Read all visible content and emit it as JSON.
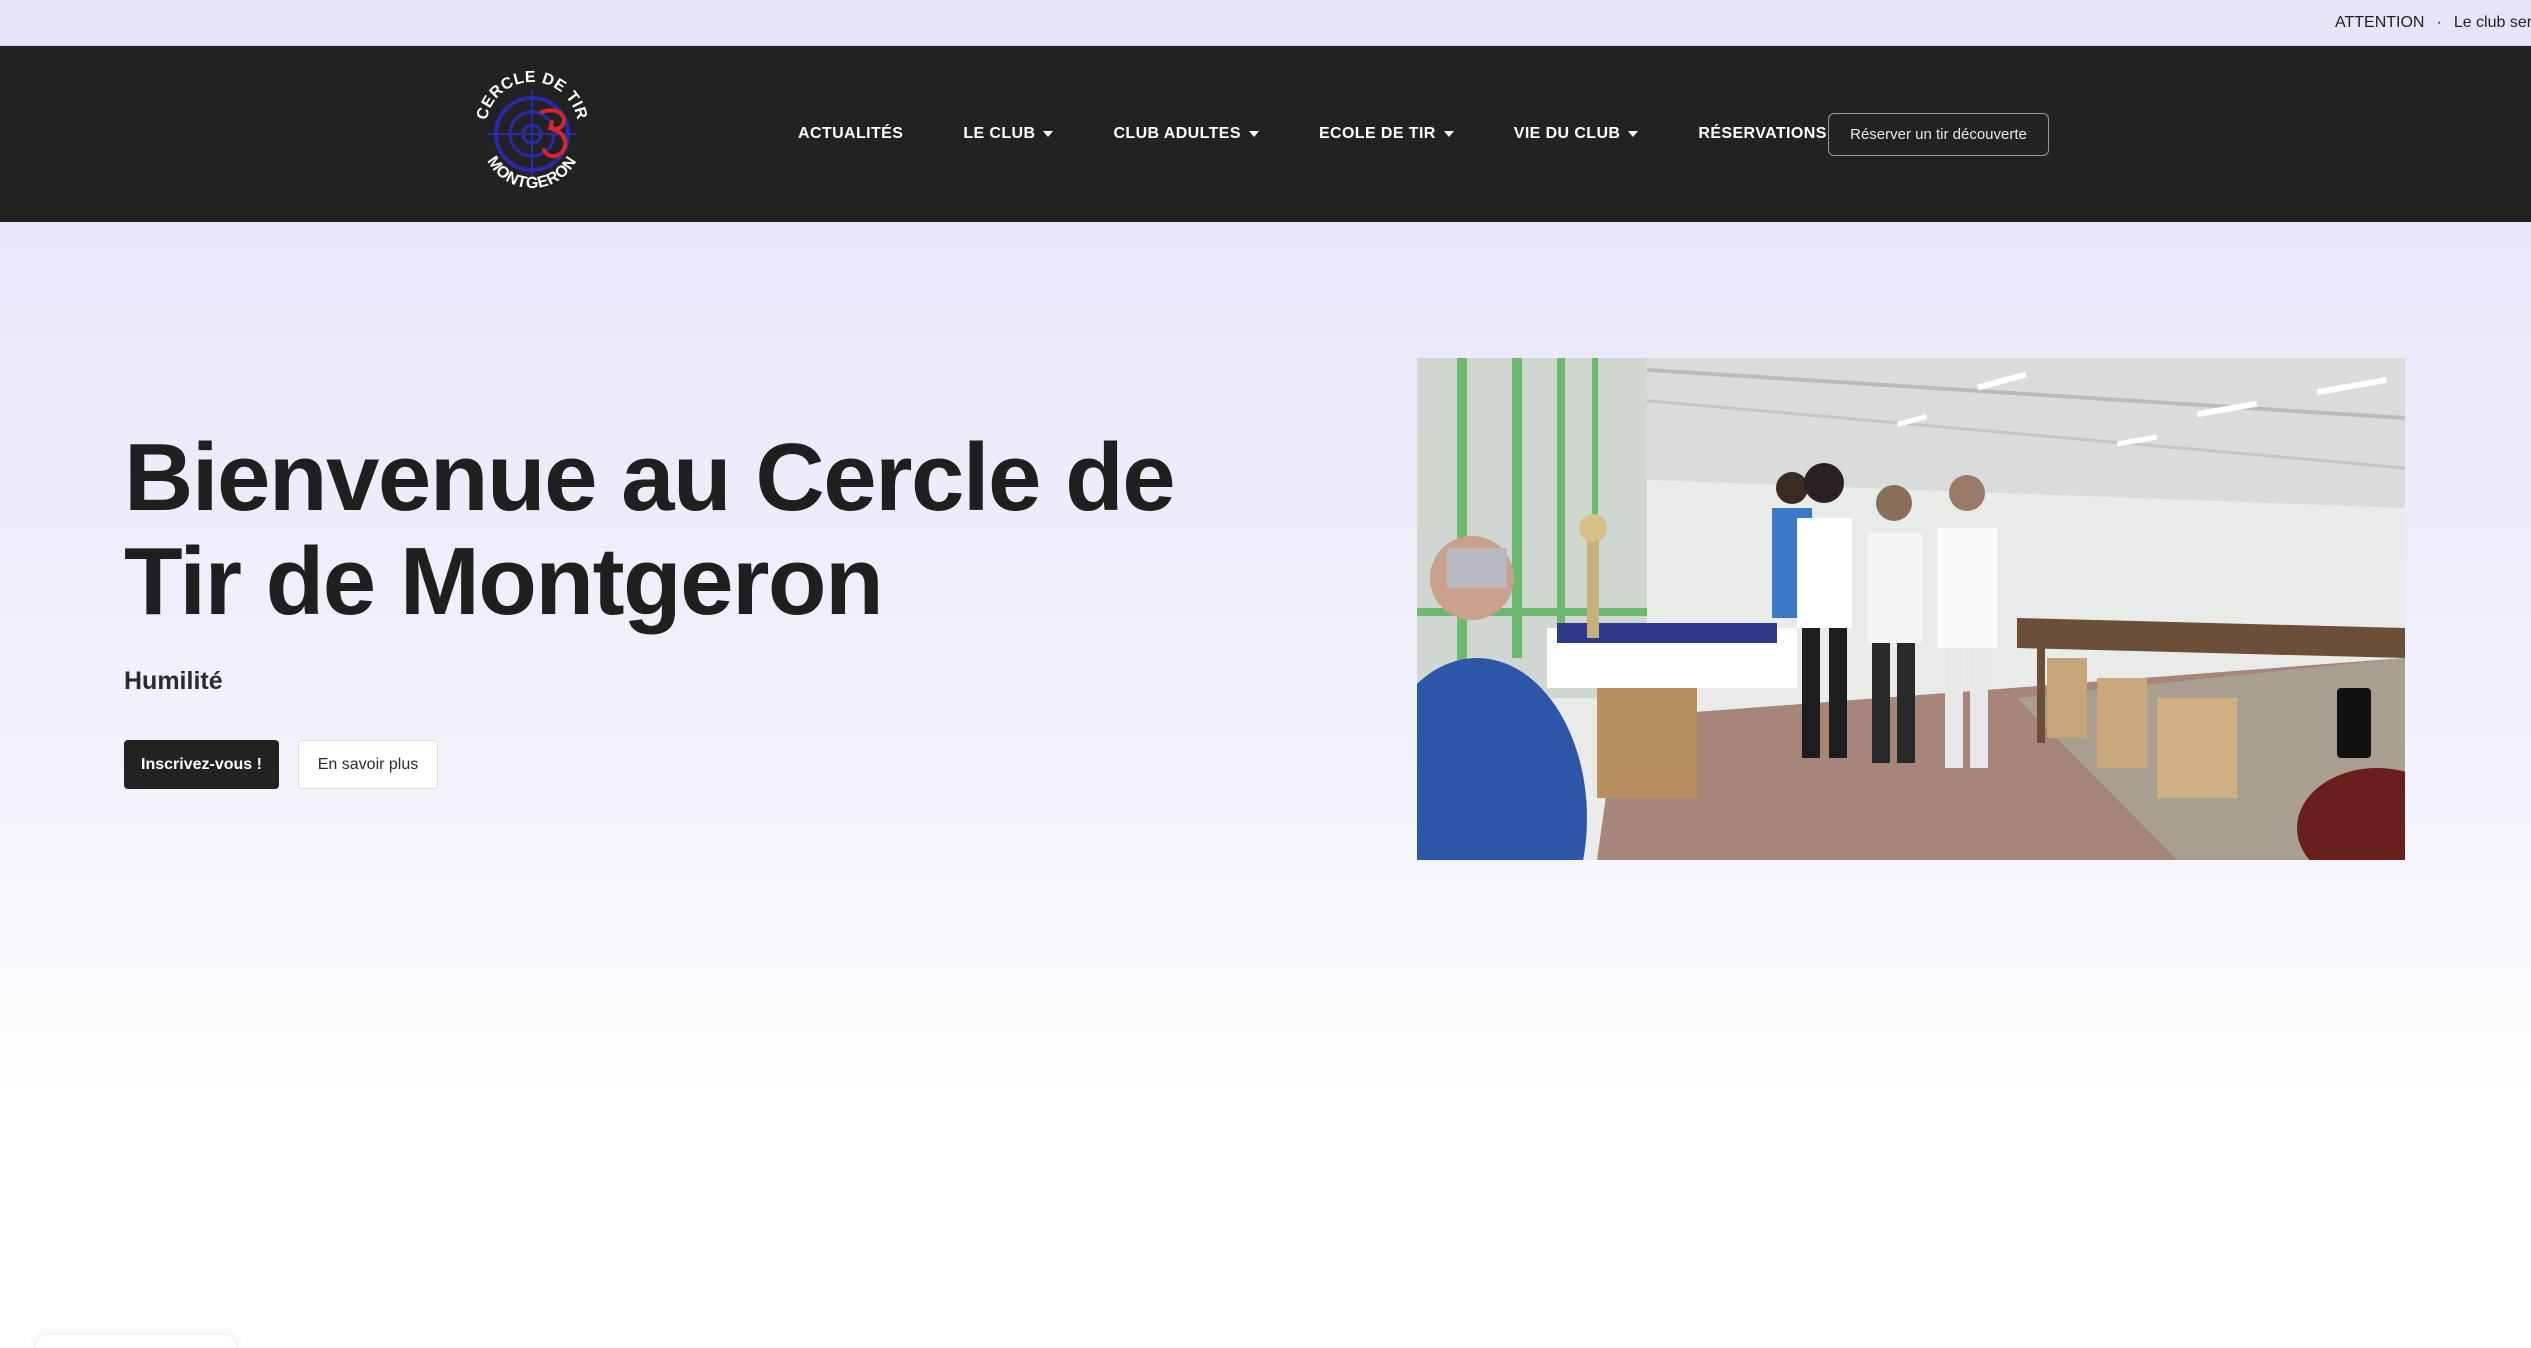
{
  "announcement": {
    "label": "ATTENTION",
    "separator": "·",
    "text": "Le club ser"
  },
  "header": {
    "logo": {
      "top_text": "CERCLE DE TIR",
      "bottom_text": "MONTGERON",
      "colors": {
        "ring": "#2a2aa8",
        "accent": "#d8252b"
      }
    },
    "nav": [
      {
        "label": "ACTUALITÉS",
        "dropdown": false
      },
      {
        "label": "LE CLUB",
        "dropdown": true
      },
      {
        "label": "CLUB ADULTES",
        "dropdown": true
      },
      {
        "label": "ECOLE DE TIR",
        "dropdown": true
      },
      {
        "label": "VIE DU CLUB",
        "dropdown": true
      },
      {
        "label": "RÉSERVATIONS",
        "dropdown": false
      }
    ],
    "cta_label": "Réserver un tir découverte"
  },
  "hero": {
    "title_line1": "Bienvenue au Cercle de",
    "title_line2": "Tir de Montgeron",
    "subtitle": "Humilité",
    "primary_button": "Inscrivez-vous !",
    "secondary_button": "En savoir plus"
  },
  "colors": {
    "header_bg": "#222222",
    "announcement_bg": "#e6e4fa",
    "hero_gradient_top": "#e9e6fa"
  }
}
